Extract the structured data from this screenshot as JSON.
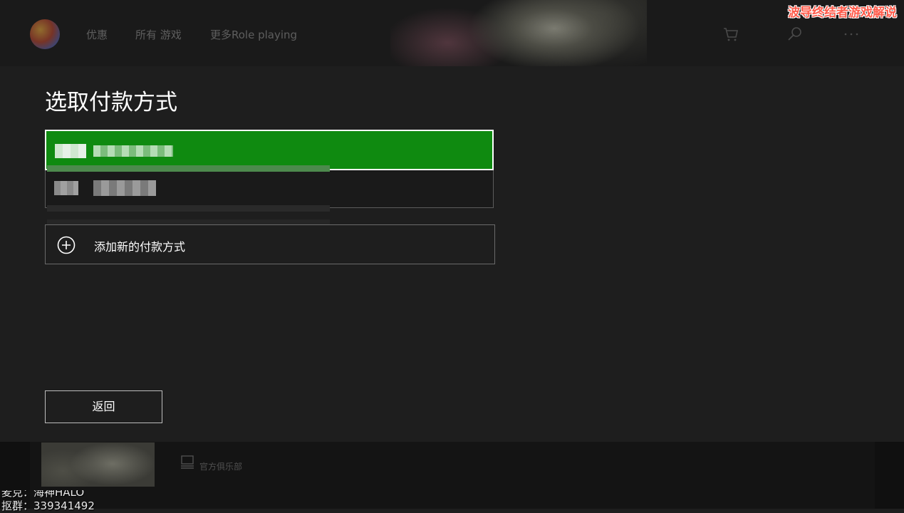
{
  "nav": {
    "offers": "优惠",
    "all_games": "所有 游戏",
    "more": "更多Role playing",
    "icons": [
      "avatar",
      "cart-icon",
      "search-icon",
      "more-icon"
    ]
  },
  "streamer_tag": "波导终结者游戏解说",
  "dialog": {
    "title": "选取付款方式",
    "add_payment": "添加新的付款方式",
    "back": "返回"
  },
  "colors": {
    "selected_option": "#0f8a10",
    "background": "#1e1e1e",
    "streamer_tag": "#ff5a4a"
  },
  "bottom": {
    "club_label": "官方俱乐部",
    "overlay_line_1": "麦克：海神HALO",
    "overlay_line_2": "抠群：339341492"
  }
}
